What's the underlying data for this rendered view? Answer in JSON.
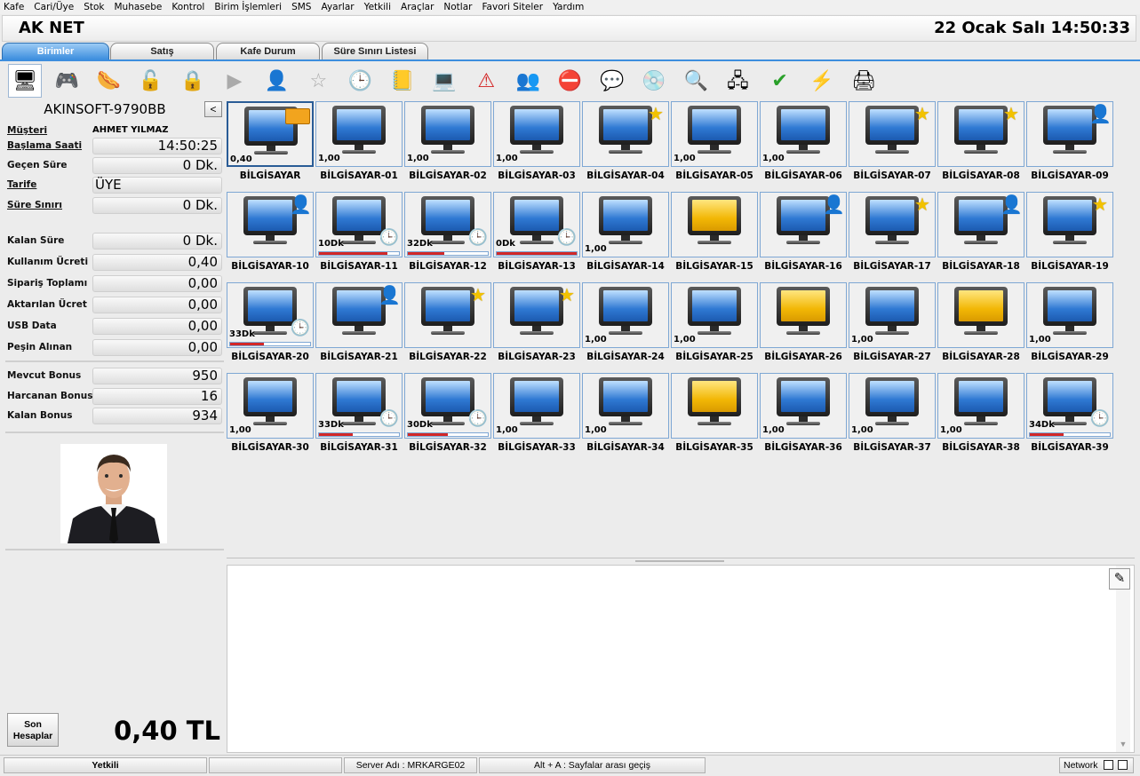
{
  "menu": [
    "Kafe",
    "Cari/Üye",
    "Stok",
    "Muhasebe",
    "Kontrol",
    "Birim İşlemleri",
    "SMS",
    "Ayarlar",
    "Yetkili",
    "Araçlar",
    "Notlar",
    "Favori Siteler",
    "Yardım"
  ],
  "app": {
    "title": "AK NET",
    "datetime": "22 Ocak Salı  14:50:33"
  },
  "tabs": [
    "Birimler",
    "Satış",
    "Kafe Durum",
    "Süre Sınırı Listesi"
  ],
  "toolbar_icons": [
    "monitor-icon",
    "gamepad-icon",
    "sausage-icon",
    "unlock-icon",
    "lock-icon",
    "play-icon",
    "person-icon",
    "star-icon",
    "clock-icon",
    "note-icon",
    "computer-icon",
    "warning-icon",
    "users-icon",
    "stop-icon",
    "user-chat-icon",
    "disk-icon",
    "search-icon",
    "network-icon",
    "check-icon",
    "lightning-icon",
    "printer-icon"
  ],
  "left": {
    "pc_name": "AKINSOFT-9790BB",
    "collapse_label": "<",
    "musteri_label": "Müşteri",
    "musteri_value": "AHMET YILMAZ",
    "fields": [
      {
        "label": "Başlama Saati",
        "value": "14:50:25"
      },
      {
        "label": "Geçen Süre",
        "value": "0 Dk."
      },
      {
        "label": "Tarife",
        "value": "ÜYE"
      },
      {
        "label": "Süre Sınırı",
        "value": "0 Dk."
      },
      {
        "label": "Kalan Süre",
        "value": "0 Dk."
      },
      {
        "label": "Kullanım Ücreti",
        "value": "0,40"
      },
      {
        "label": "Sipariş Toplamı",
        "value": "0,00"
      },
      {
        "label": "Aktarılan Ücret",
        "value": "0,00"
      },
      {
        "label": "USB Data",
        "value": "0,00"
      },
      {
        "label": "Peşin Alınan",
        "value": "0,00"
      },
      {
        "label": "Mevcut Bonus",
        "value": "950"
      },
      {
        "label": "Harcanan Bonus",
        "value": "16"
      },
      {
        "label": "Kalan Bonus",
        "value": "934"
      }
    ],
    "son_hesaplar_label": "Son Hesaplar",
    "total": "0,40 TL"
  },
  "computers": [
    {
      "name": "BİLGİSAYAR",
      "value": "0,40",
      "badge": "card",
      "selected": true
    },
    {
      "name": "BİLGİSAYAR-01",
      "value": "1,00"
    },
    {
      "name": "BİLGİSAYAR-02",
      "value": "1,00"
    },
    {
      "name": "BİLGİSAYAR-03",
      "value": "1,00"
    },
    {
      "name": "BİLGİSAYAR-04",
      "value": "",
      "badge": "star"
    },
    {
      "name": "BİLGİSAYAR-05",
      "value": "1,00"
    },
    {
      "name": "BİLGİSAYAR-06",
      "value": "1,00"
    },
    {
      "name": "BİLGİSAYAR-07",
      "value": "",
      "badge": "star"
    },
    {
      "name": "BİLGİSAYAR-08",
      "value": "",
      "badge": "star"
    },
    {
      "name": "BİLGİSAYAR-09",
      "value": "",
      "badge": "user"
    },
    {
      "name": "BİLGİSAYAR-10",
      "value": "",
      "badge": "user"
    },
    {
      "name": "BİLGİSAYAR-11",
      "value": "10Dk",
      "badge": "clock",
      "progress": 0.85
    },
    {
      "name": "BİLGİSAYAR-12",
      "value": "32Dk",
      "badge": "clock",
      "progress": 0.45
    },
    {
      "name": "BİLGİSAYAR-13",
      "value": "0Dk",
      "badge": "clock",
      "progress": 1.0
    },
    {
      "name": "BİLGİSAYAR-14",
      "value": "1,00"
    },
    {
      "name": "BİLGİSAYAR-15",
      "value": "",
      "screen": "yellow"
    },
    {
      "name": "BİLGİSAYAR-16",
      "value": "",
      "badge": "user"
    },
    {
      "name": "BİLGİSAYAR-17",
      "value": "",
      "badge": "star"
    },
    {
      "name": "BİLGİSAYAR-18",
      "value": "",
      "badge": "user"
    },
    {
      "name": "BİLGİSAYAR-19",
      "value": "",
      "badge": "star"
    },
    {
      "name": "BİLGİSAYAR-20",
      "value": "33Dk",
      "badge": "clock",
      "progress": 0.42
    },
    {
      "name": "BİLGİSAYAR-21",
      "value": "",
      "badge": "user"
    },
    {
      "name": "BİLGİSAYAR-22",
      "value": "",
      "badge": "star"
    },
    {
      "name": "BİLGİSAYAR-23",
      "value": "",
      "badge": "star"
    },
    {
      "name": "BİLGİSAYAR-24",
      "value": "1,00"
    },
    {
      "name": "BİLGİSAYAR-25",
      "value": "1,00"
    },
    {
      "name": "BİLGİSAYAR-26",
      "value": "",
      "screen": "yellow"
    },
    {
      "name": "BİLGİSAYAR-27",
      "value": "1,00"
    },
    {
      "name": "BİLGİSAYAR-28",
      "value": "",
      "screen": "yellow"
    },
    {
      "name": "BİLGİSAYAR-29",
      "value": "1,00"
    },
    {
      "name": "BİLGİSAYAR-30",
      "value": "1,00"
    },
    {
      "name": "BİLGİSAYAR-31",
      "value": "33Dk",
      "badge": "clock",
      "progress": 0.42
    },
    {
      "name": "BİLGİSAYAR-32",
      "value": "30Dk",
      "badge": "clock",
      "progress": 0.5
    },
    {
      "name": "BİLGİSAYAR-33",
      "value": "1,00"
    },
    {
      "name": "BİLGİSAYAR-34",
      "value": "1,00"
    },
    {
      "name": "BİLGİSAYAR-35",
      "value": "",
      "screen": "yellow"
    },
    {
      "name": "BİLGİSAYAR-36",
      "value": "1,00"
    },
    {
      "name": "BİLGİSAYAR-37",
      "value": "1,00"
    },
    {
      "name": "BİLGİSAYAR-38",
      "value": "1,00"
    },
    {
      "name": "BİLGİSAYAR-39",
      "value": "34Dk",
      "badge": "clock",
      "progress": 0.42
    }
  ],
  "status": {
    "yetkili": "Yetkili",
    "blank": "",
    "server": "Server Adı : MRKARGE02",
    "hint": "Alt + A : Sayfalar arası geçiş",
    "network": "Network"
  }
}
